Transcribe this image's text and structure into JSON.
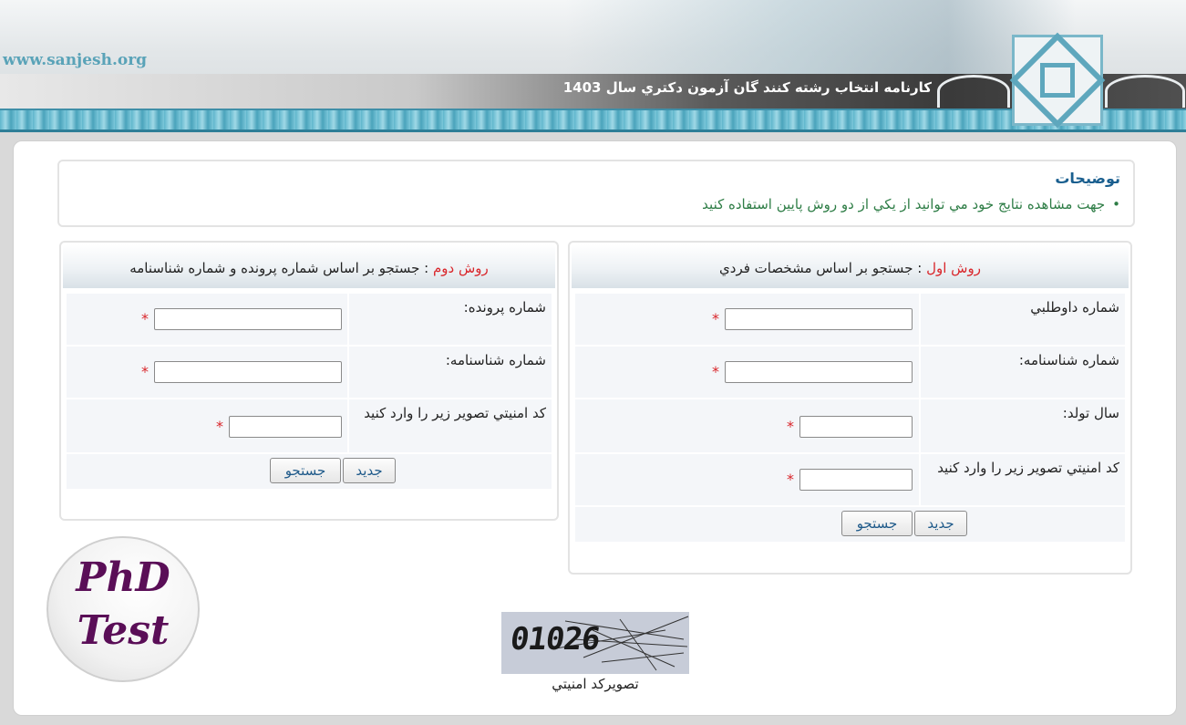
{
  "header": {
    "site_url": "www.sanjesh.org",
    "title": "کارنامه انتخاب رشته کنند گان آزمون دکتري سال 1403"
  },
  "notes": {
    "title": "توضيحات",
    "item": "جهت مشاهده نتايج خود مي توانيد از يکي از دو روش پايين استفاده کنيد"
  },
  "method1": {
    "label": "روش اول",
    "separator": " : ",
    "description": "جستجو بر اساس مشخصات فردي",
    "fields": [
      {
        "label": "شماره داوطلبي"
      },
      {
        "label": "شماره شناسنامه:"
      },
      {
        "label": "سال تولد:"
      },
      {
        "label": "کد امنيتي تصوير زير را وارد کنيد"
      }
    ],
    "search_button": "جستجو",
    "new_button": "جديد"
  },
  "method2": {
    "label": "روش دوم",
    "separator": " : ",
    "description": "جستجو بر اساس شماره پرونده و شماره شناسنامه",
    "fields": [
      {
        "label": "شماره پرونده:"
      },
      {
        "label": "شماره شناسنامه:"
      },
      {
        "label": "کد امنيتي تصوير زير را وارد کنيد"
      }
    ],
    "search_button": "جستجو",
    "new_button": "جديد"
  },
  "required_mark": "*",
  "captcha": {
    "code": "01026",
    "caption": "تصويرکد امنيتي"
  },
  "phd_logo": {
    "line1": "PhD",
    "line2": "Test"
  }
}
